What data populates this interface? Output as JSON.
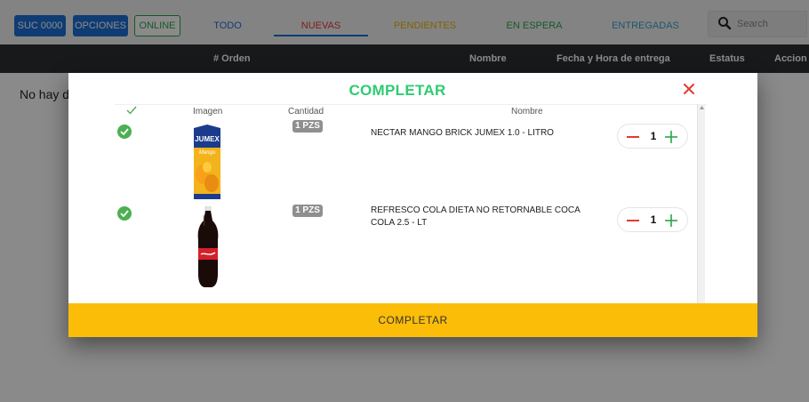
{
  "topbar": {
    "sucursal_label": "SUC 0000",
    "opciones_label": "OPCIONES",
    "online_label": "ONLINE",
    "tabs": [
      {
        "label": "TODO",
        "color": "#1f6fd6"
      },
      {
        "label": "NUEVAS",
        "color": "#e53935",
        "active": true
      },
      {
        "label": "PENDIENTES",
        "color": "#f0b400"
      },
      {
        "label": "EN ESPERA",
        "color": "#28a745"
      },
      {
        "label": "ENTREGADAS",
        "color": "#3aa0c8"
      }
    ],
    "search": {
      "placeholder": "Search",
      "icon": "search-icon"
    }
  },
  "table": {
    "headers": [
      "# Orden",
      "Nombre",
      "Fecha y Hora de entrega",
      "Estatus",
      "Accion"
    ],
    "empty_text": "No hay d"
  },
  "modal": {
    "title": "COMPLETAR",
    "close_icon": "close-icon",
    "columns": {
      "check": "check-icon",
      "imagen": "Imagen",
      "cantidad": "Cantidad",
      "nombre": "Nombre"
    },
    "items": [
      {
        "qty_badge": "1 PZS",
        "name": "NECTAR MANGO BRICK JUMEX 1.0 - LITRO",
        "quantity": "1",
        "image_icon": "jumex-mango-carton",
        "image_text": "JUMEX",
        "image_subtext": "Mango",
        "checked": true
      },
      {
        "qty_badge": "1 PZS",
        "name": "REFRESCO COLA DIETA NO RETORNABLE COCA COLA 2.5 - LT",
        "quantity": "1",
        "image_icon": "coca-cola-bottle",
        "checked": true
      }
    ],
    "complete_label": "COMPLETAR"
  },
  "colors": {
    "primary_blue": "#1f6fd6",
    "success_green": "#28a745",
    "title_green": "#2ecc71",
    "danger_red": "#e53935",
    "warning_yellow": "#fbbd08",
    "header_dark": "#2c2f33"
  }
}
